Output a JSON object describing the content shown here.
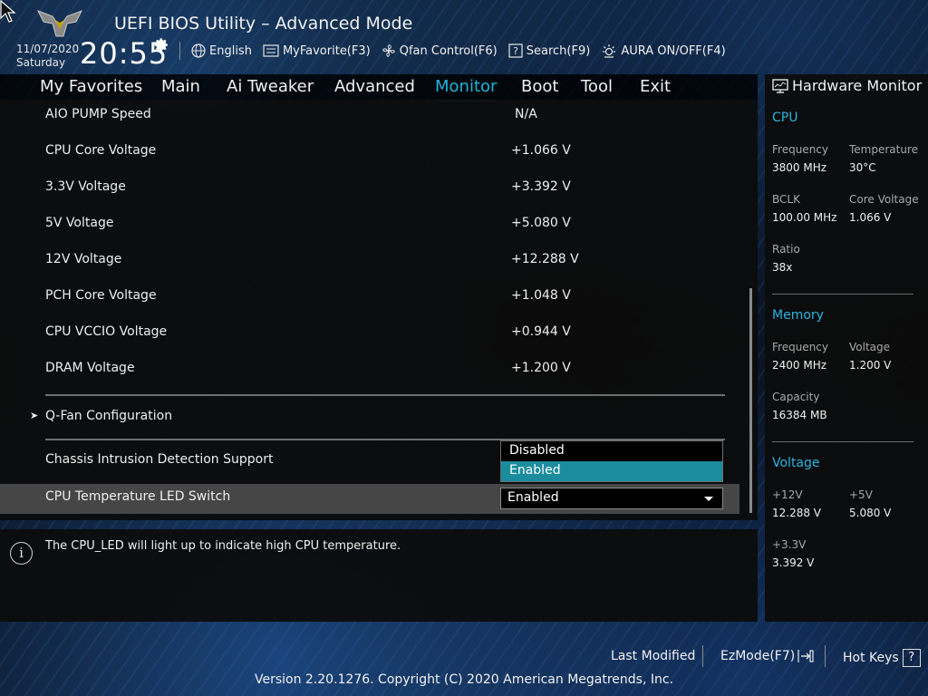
{
  "header": {
    "title": "UEFI BIOS Utility – Advanced Mode",
    "date": "11/07/2020",
    "day": "Saturday",
    "time": "20:55",
    "toolbar": {
      "language": "English",
      "favorite": "MyFavorite(F3)",
      "qfan": "Qfan Control(F6)",
      "search": "Search(F9)",
      "aura": "AURA ON/OFF(F4)"
    }
  },
  "nav": {
    "tabs": [
      "My Favorites",
      "Main",
      "Ai Tweaker",
      "Advanced",
      "Monitor",
      "Boot",
      "Tool",
      "Exit"
    ],
    "active": "Monitor"
  },
  "monitor": {
    "rows": [
      {
        "label": "AIO PUMP Speed",
        "value": "N/A"
      },
      {
        "label": "CPU Core Voltage",
        "value": "+1.066 V"
      },
      {
        "label": "3.3V Voltage",
        "value": "+3.392 V"
      },
      {
        "label": "5V Voltage",
        "value": "+5.080 V"
      },
      {
        "label": "12V Voltage",
        "value": "+12.288 V"
      },
      {
        "label": "PCH Core Voltage",
        "value": "+1.048 V"
      },
      {
        "label": "CPU VCCIO Voltage",
        "value": "+0.944 V"
      },
      {
        "label": "DRAM Voltage",
        "value": "+1.200 V"
      }
    ],
    "qfan_label": "Q-Fan Configuration",
    "chassis_label": "Chassis Intrusion Detection Support",
    "led_label": "CPU Temperature LED Switch",
    "led_value": "Enabled",
    "popup_options": [
      "Disabled",
      "Enabled"
    ],
    "popup_selected": "Enabled"
  },
  "help": {
    "text": "The CPU_LED will light up to indicate high CPU temperature."
  },
  "hardware_monitor": {
    "title": "Hardware Monitor",
    "cpu": {
      "heading": "CPU",
      "frequency_label": "Frequency",
      "frequency": "3800 MHz",
      "temperature_label": "Temperature",
      "temperature": "30°C",
      "bclk_label": "BCLK",
      "bclk": "100.00 MHz",
      "core_voltage_label": "Core Voltage",
      "core_voltage": "1.066 V",
      "ratio_label": "Ratio",
      "ratio": "38x"
    },
    "memory": {
      "heading": "Memory",
      "frequency_label": "Frequency",
      "frequency": "2400 MHz",
      "voltage_label": "Voltage",
      "voltage": "1.200 V",
      "capacity_label": "Capacity",
      "capacity": "16384 MB"
    },
    "voltage": {
      "heading": "Voltage",
      "v12_label": "+12V",
      "v12": "12.288 V",
      "v5_label": "+5V",
      "v5": "5.080 V",
      "v33_label": "+3.3V",
      "v33": "3.392 V"
    }
  },
  "footer": {
    "last_modified": "Last Modified",
    "ezmode": "EzMode(F7)",
    "hotkeys": "Hot Keys",
    "hotkey_symbol": "?",
    "copyright": "Version 2.20.1276. Copyright (C) 2020 American Megatrends, Inc."
  },
  "colors": {
    "accent": "#1fb3d8",
    "selected_option": "#1a8c9e",
    "highlight_row": "#464646"
  }
}
